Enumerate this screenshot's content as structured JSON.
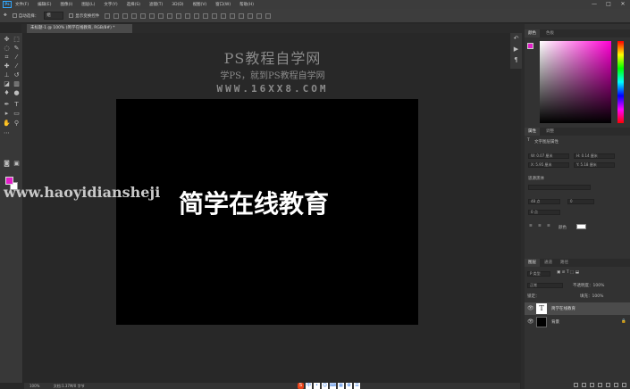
{
  "menu": {
    "logo": "Ps",
    "items": [
      "文件(F)",
      "编辑(E)",
      "图像(I)",
      "图层(L)",
      "文字(Y)",
      "选择(S)",
      "滤镜(T)",
      "3D(D)",
      "视图(V)",
      "窗口(W)",
      "帮助(H)"
    ],
    "window_controls": [
      "—",
      "□",
      "✕"
    ]
  },
  "options_bar": {
    "auto_select": "自动选择：",
    "auto_select_value": "组",
    "show_transform": "显示变换控件"
  },
  "document_tab": {
    "label": "未标题-1 @ 100% (简学在线教育, RGB/8#) *"
  },
  "canvas": {
    "watermark_title": "PS教程自学网",
    "watermark_subtitle": "学PS，就到PS教程自学网",
    "watermark_url": "WWW.16XX8.COM",
    "overlay_url": "www.haoyidiansheji",
    "main_text": "简学在线教育"
  },
  "status_bar": {
    "zoom": "100%",
    "doc_info": "文档:1.37M/0 字节"
  },
  "right_panel": {
    "color_tabs": [
      "颜色",
      "色板"
    ],
    "props_tabs": [
      "属性",
      "调整"
    ],
    "props_layer": "文字图层属性",
    "w_field": "W: 0.07 厘米",
    "h_field": "H: 0.14 厘米",
    "x_field": "X: 5.95 厘米",
    "y_field": "Y: 5.18 厘米",
    "font_family": "思源黑体",
    "font_size": "48 点",
    "tracking": "0",
    "leading": "0 点",
    "color_label": "颜色",
    "layers_tabs": [
      "图层",
      "通道",
      "路径"
    ],
    "filter_kind": "P 类型",
    "blend_mode": "正常",
    "opacity": "不透明度：100%",
    "lock": "锁定：",
    "fill": "填充：100%",
    "layers": [
      {
        "name": "简学在线教育",
        "type": "text",
        "selected": true
      },
      {
        "name": "背景",
        "type": "fill",
        "selected": false
      }
    ]
  },
  "taskbar": {
    "icons": [
      "S",
      "中",
      "•",
      "☺",
      "⌨",
      "▦",
      "✿",
      "☰"
    ]
  }
}
